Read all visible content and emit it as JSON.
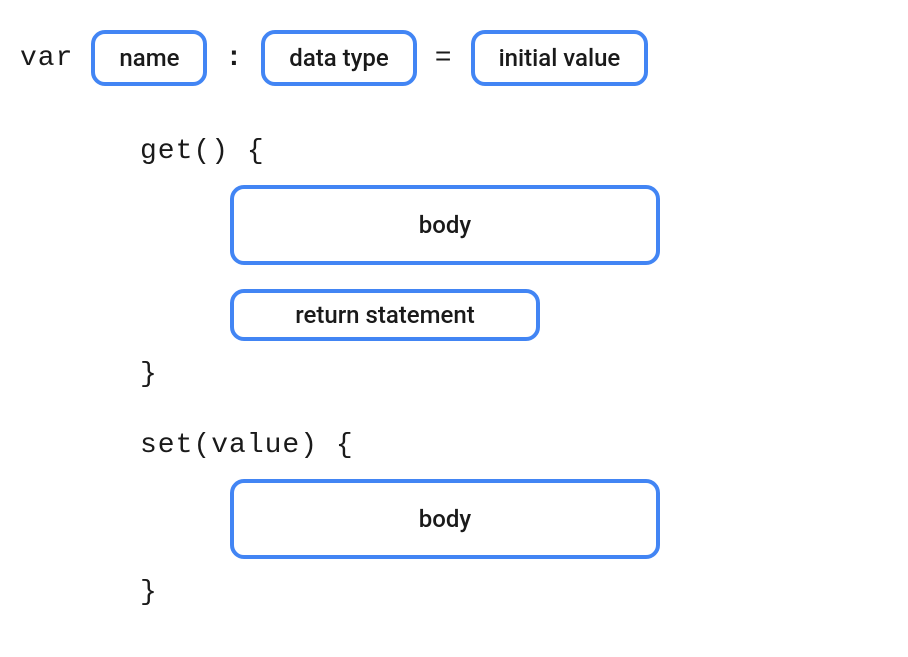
{
  "declaration": {
    "keyword": "var",
    "name_placeholder": "name",
    "colon": ":",
    "type_placeholder": "data type",
    "equals": "=",
    "value_placeholder": "initial value"
  },
  "getter": {
    "signature": "get()  {",
    "body_placeholder": "body",
    "return_placeholder": "return statement",
    "close": "}"
  },
  "setter": {
    "signature": "set(value)  {",
    "body_placeholder": "body",
    "close": "}"
  }
}
